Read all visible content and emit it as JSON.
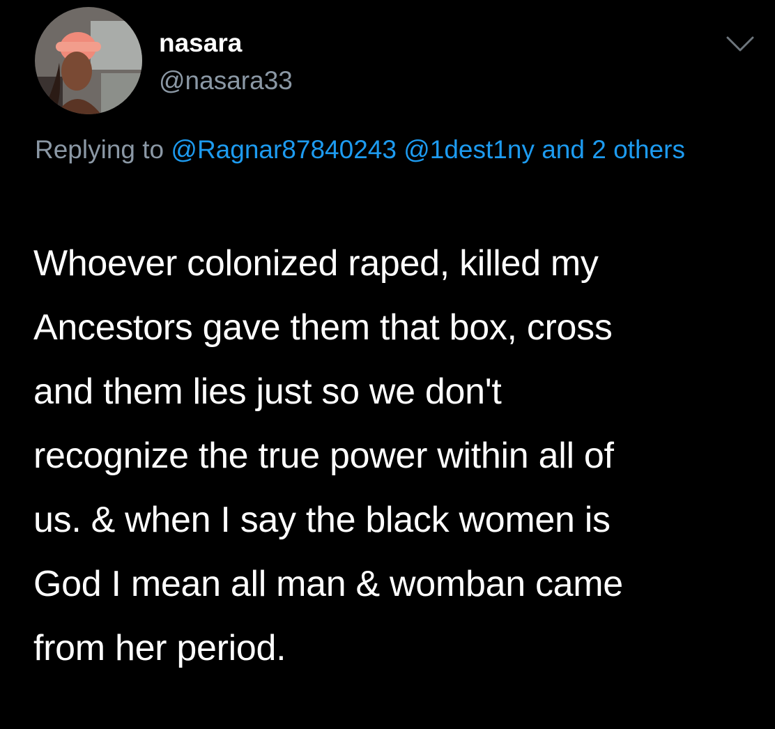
{
  "theme": {
    "background": "#000000",
    "text_primary": "#ffffff",
    "text_secondary": "#8b98a5",
    "accent": "#1d9bf0"
  },
  "tweet": {
    "author": {
      "display_name": "nasara",
      "handle": "@nasara33",
      "avatar_icon": "avatar-photo"
    },
    "menu_icon": "chevron-down-icon",
    "replying_to": {
      "prefix": "Replying to ",
      "mentions": [
        "@Ragnar87840243",
        "@1dest1ny"
      ],
      "suffix": "and 2 others"
    },
    "text": "Whoever colonized raped, killed my\nAncestors gave them that box, cross\nand them lies just so we don't\nrecognize the true power within all of\nus. & when I say the black women is\nGod I mean all man & womban came\nfrom her period."
  }
}
